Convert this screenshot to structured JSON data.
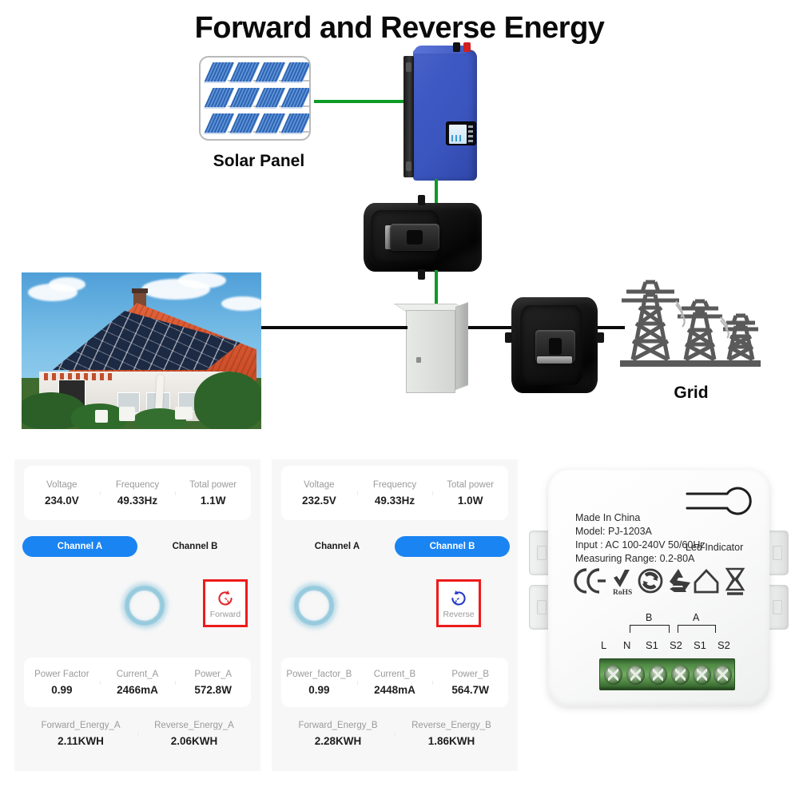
{
  "title": "Forward and Reverse Energy",
  "diagram": {
    "solar_panel_label": "Solar Panel",
    "grid_label": "Grid",
    "icons": {
      "solar_array": "solar-panel-array-icon",
      "inverter": "grid-tie-inverter-icon",
      "ct_clamp_solar": "current-transformer-clamp-icon",
      "ct_clamp_grid": "current-transformer-clamp-icon",
      "meter_cabinet": "distribution-box-icon",
      "pylons": "power-pylon-icon",
      "house": "house-with-solar-roof-photo"
    },
    "wire_colors": {
      "dc_solar": "#0c9b25",
      "ac_mains": "#0b0b0b"
    }
  },
  "app": {
    "accent_color": "#1a84f2",
    "highlight_color": "#ee1b1b",
    "panel_a": {
      "top_metrics": [
        {
          "label": "Voltage",
          "value": "234.0V"
        },
        {
          "label": "Frequency",
          "value": "49.33Hz"
        },
        {
          "label": "Total power",
          "value": "1.1W"
        }
      ],
      "tabs": [
        {
          "label": "Channel A",
          "active": true
        },
        {
          "label": "Channel B",
          "active": false
        }
      ],
      "direction": {
        "label": "Forward",
        "icon": "clockwise-refresh-icon",
        "color": "#e0262b"
      },
      "mid_metrics": [
        {
          "label": "Power Factor",
          "value": "0.99"
        },
        {
          "label": "Current_A",
          "value": "2466mA"
        },
        {
          "label": "Power_A",
          "value": "572.8W"
        }
      ],
      "bottom_metrics": [
        {
          "label": "Forward_Energy_A",
          "value": "2.11KWH"
        },
        {
          "label": "Reverse_Energy_A",
          "value": "2.06KWH"
        }
      ]
    },
    "panel_b": {
      "top_metrics": [
        {
          "label": "Voltage",
          "value": "232.5V"
        },
        {
          "label": "Frequency",
          "value": "49.33Hz"
        },
        {
          "label": "Total power",
          "value": "1.0W"
        }
      ],
      "tabs": [
        {
          "label": "Channel A",
          "active": false
        },
        {
          "label": "Channel B",
          "active": true
        }
      ],
      "direction": {
        "label": "Reverse",
        "icon": "counter-clockwise-refresh-icon",
        "color": "#2438c8"
      },
      "mid_metrics": [
        {
          "label": "Power_factor_B",
          "value": "0.99"
        },
        {
          "label": "Current_B",
          "value": "2448mA"
        },
        {
          "label": "Power_B",
          "value": "564.7W"
        }
      ],
      "bottom_metrics": [
        {
          "label": "Forward_Energy_B",
          "value": "2.28KWH"
        },
        {
          "label": "Reverse_Energy_B",
          "value": "1.86KWH"
        }
      ]
    }
  },
  "device": {
    "spec_lines": [
      "Made In China",
      "Model: PJ-1203A",
      "Input : AC 100-240V 50/60Hz",
      "Measuring Range: 0.2-80A"
    ],
    "led_indicator_label": "Led Indicator",
    "cert_icons": [
      "ce-mark-icon",
      "rohs-check-icon",
      "rohs-label",
      "green-dot-recycling-icon",
      "recycle-triangle-icon",
      "indoor-use-house-icon",
      "weee-crossed-bin-icon"
    ],
    "rohs_text": "RoHS",
    "terminal_labels": [
      "L",
      "N",
      "S1",
      "S2",
      "S1",
      "S2"
    ],
    "terminal_groups": [
      {
        "label": "B",
        "covers": "S1 S2"
      },
      {
        "label": "A",
        "covers": "S1 S2"
      }
    ]
  }
}
